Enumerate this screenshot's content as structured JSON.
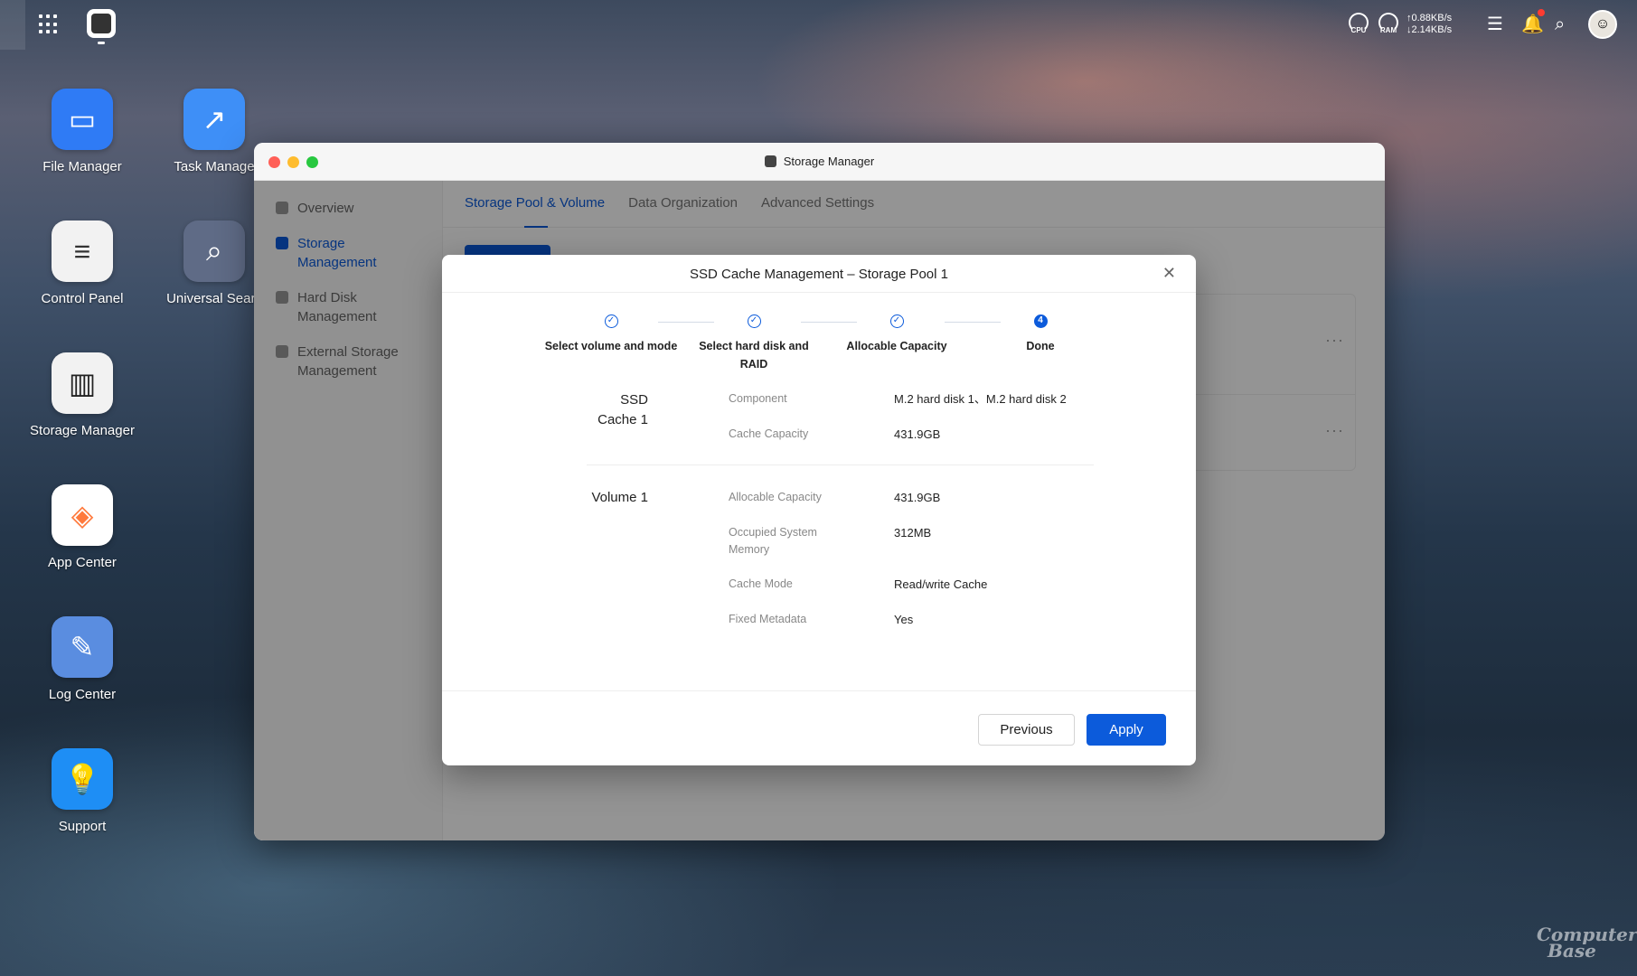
{
  "topbar": {
    "cpu_label": "CPU",
    "ram_label": "RAM",
    "upload_speed": "↑0.88KB/s",
    "download_speed": "↓2.14KB/s"
  },
  "desktop": {
    "icons": [
      {
        "label": "File Manager",
        "icon": "folder-icon",
        "color": "#2f7bf5"
      },
      {
        "label": "Task Manage",
        "icon": "chart-line-icon",
        "color": "#3e8ff7"
      },
      {
        "label": "Control Panel",
        "icon": "sliders-icon",
        "color": "#f2f2f2"
      },
      {
        "label": "Universal Searc",
        "icon": "search-doc-icon",
        "color": "#5f6b86"
      },
      {
        "label": "Storage Manager",
        "icon": "storage-icon",
        "color": "#f2f2f2"
      },
      {
        "label": "App Center",
        "icon": "app-center-icon",
        "color": "#ffffff"
      },
      {
        "label": "Log Center",
        "icon": "log-icon",
        "color": "#5a8de0"
      },
      {
        "label": "Support",
        "icon": "lightbulb-icon",
        "color": "#1e8ef5"
      }
    ]
  },
  "window": {
    "title": "Storage Manager",
    "sidebar": [
      {
        "label": "Overview"
      },
      {
        "label": "Storage Management"
      },
      {
        "label": "Hard Disk Management"
      },
      {
        "label": "External Storage Management"
      }
    ],
    "tabs": [
      {
        "label": "Storage Pool & Volume"
      },
      {
        "label": "Data Organization"
      },
      {
        "label": "Advanced Settings"
      }
    ]
  },
  "modal": {
    "title": "SSD Cache Management – Storage Pool 1",
    "steps": [
      {
        "label": "Select volume and mode",
        "state": "done"
      },
      {
        "label": "Select hard disk and RAID",
        "state": "done"
      },
      {
        "label": "Allocable Capacity",
        "state": "done"
      },
      {
        "label": "Done",
        "number": "4",
        "state": "current"
      }
    ],
    "ssd_cache": {
      "label": "SSD Cache 1",
      "component_key": "Component",
      "component_val": "M.2 hard disk 1、M.2 hard disk 2",
      "capacity_key": "Cache Capacity",
      "capacity_val": "431.9GB"
    },
    "volume": {
      "label": "Volume 1",
      "allocable_key": "Allocable Capacity",
      "allocable_val": "431.9GB",
      "memory_key": "Occupied System Memory",
      "memory_val": "312MB",
      "mode_key": "Cache Mode",
      "mode_val": "Read/write Cache",
      "metadata_key": "Fixed Metadata",
      "metadata_val": "Yes"
    },
    "buttons": {
      "previous": "Previous",
      "apply": "Apply"
    }
  },
  "watermark": {
    "line1": "Computer",
    "line2": "Base"
  },
  "colors": {
    "accent": "#0c5bdb",
    "close": "#ff5f57",
    "minimize": "#febc2e",
    "zoom": "#28c840"
  }
}
